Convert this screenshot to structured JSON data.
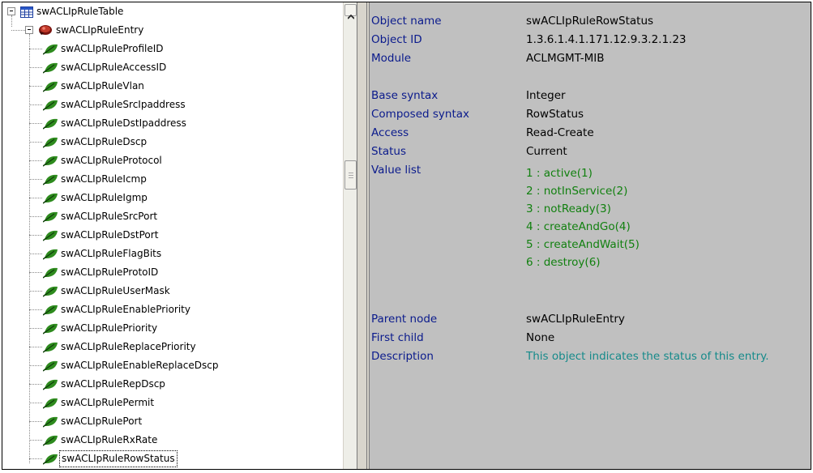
{
  "tree": {
    "root_label": "swACLIpRuleTable",
    "entry_label": "swACLIpRuleEntry",
    "items": [
      "swACLIpRuleProfileID",
      "swACLIpRuleAccessID",
      "swACLIpRuleVlan",
      "swACLIpRuleSrcIpaddress",
      "swACLIpRuleDstIpaddress",
      "swACLIpRuleDscp",
      "swACLIpRuleProtocol",
      "swACLIpRuleIcmp",
      "swACLIpRuleIgmp",
      "swACLIpRuleSrcPort",
      "swACLIpRuleDstPort",
      "swACLIpRuleFlagBits",
      "swACLIpRuleProtoID",
      "swACLIpRuleUserMask",
      "swACLIpRuleEnablePriority",
      "swACLIpRulePriority",
      "swACLIpRuleReplacePriority",
      "swACLIpRuleEnableReplaceDscp",
      "swACLIpRuleRepDscp",
      "swACLIpRulePermit",
      "swACLIpRulePort",
      "swACLIpRuleRxRate",
      "swACLIpRuleRowStatus"
    ],
    "selected_index": 22
  },
  "detail": {
    "object_name": {
      "key": "Object name",
      "value": "swACLIpRuleRowStatus"
    },
    "object_id": {
      "key": "Object ID",
      "value": "1.3.6.1.4.1.171.12.9.3.2.1.23"
    },
    "module": {
      "key": "Module",
      "value": "ACLMGMT-MIB"
    },
    "base_syntax": {
      "key": "Base syntax",
      "value": "Integer"
    },
    "composed_syntax": {
      "key": "Composed syntax",
      "value": "RowStatus"
    },
    "access": {
      "key": "Access",
      "value": "Read-Create"
    },
    "status": {
      "key": "Status",
      "value": "Current"
    },
    "value_list": {
      "key": "Value list",
      "items": [
        "1 : active(1)",
        "2 : notInService(2)",
        "3 : notReady(3)",
        "4 : createAndGo(4)",
        "5 : createAndWait(5)",
        "6 : destroy(6)"
      ]
    },
    "parent_node": {
      "key": "Parent node",
      "value": "swACLIpRuleEntry"
    },
    "first_child": {
      "key": "First child",
      "value": "None"
    },
    "description": {
      "key": "Description",
      "value": "This object indicates the status of this entry."
    }
  },
  "colors": {
    "detail_bg": "#c0c0c0",
    "key_text": "#0a1a8c",
    "value_list_text": "#11800f",
    "description_text": "#158a8a",
    "leaf_icon": "#2e8b1e"
  },
  "icons": {
    "root": "table-icon",
    "entry": "entry-icon",
    "leaf": "leaf-icon",
    "scroll_up": "scroll-up-arrow-icon"
  }
}
